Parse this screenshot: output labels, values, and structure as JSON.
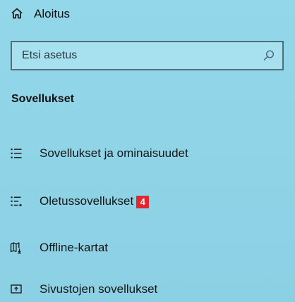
{
  "home": {
    "label": "Aloitus",
    "icon": "home-icon"
  },
  "search": {
    "placeholder": "Etsi asetus",
    "value": "",
    "icon": "search-icon"
  },
  "section": {
    "title": "Sovellukset"
  },
  "nav": {
    "items": [
      {
        "label": "Sovellukset ja ominaisuudet",
        "icon": "apps-features-icon"
      },
      {
        "label": "Oletussovellukset",
        "icon": "default-apps-icon",
        "badge": "4",
        "badge_color": "#e3262b"
      },
      {
        "label": "Offline-kartat",
        "icon": "offline-maps-icon"
      },
      {
        "label": "Sivustojen sovellukset",
        "icon": "apps-for-websites-icon"
      }
    ]
  },
  "colors": {
    "background": "#8fd3e8",
    "search_border": "#4f6f7a",
    "text": "#151515"
  }
}
